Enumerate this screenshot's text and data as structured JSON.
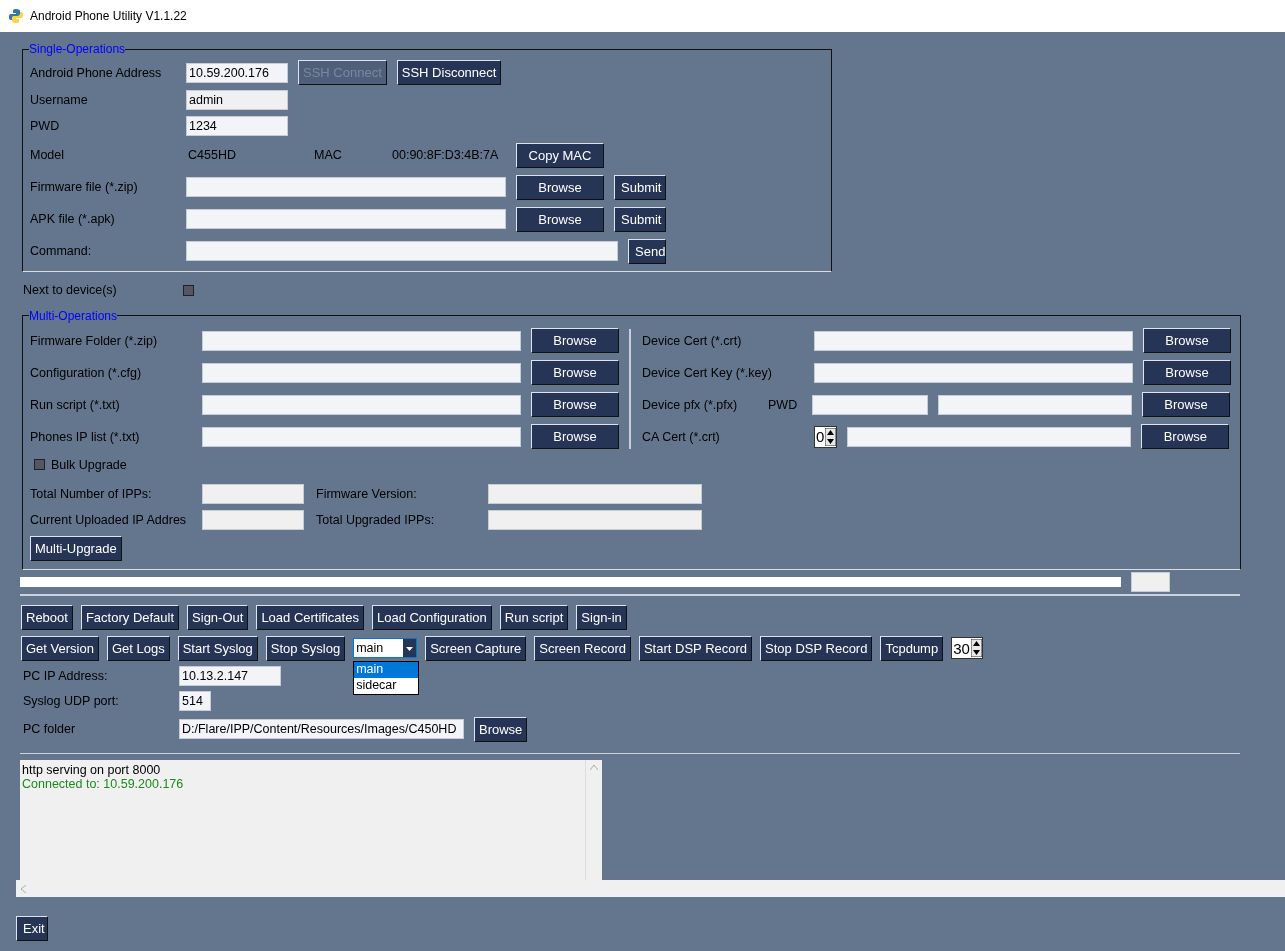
{
  "window": {
    "title": "Android Phone Utility V1.1.22"
  },
  "single_ops": {
    "title": "Single-Operations",
    "address": {
      "label": "Android Phone Address",
      "value": "10.59.200.176"
    },
    "ssh_buttons": [
      {
        "label": "SSH Connect",
        "disabled": true
      },
      {
        "label": "SSH Disconnect",
        "disabled": false
      }
    ],
    "username": {
      "label": "Username",
      "value": "admin"
    },
    "pwd": {
      "label": "PWD",
      "value": "1234"
    },
    "model": {
      "label": "Model",
      "value": "C455HD",
      "mac_label": "MAC",
      "mac_value": "00:90:8F:D3:4B:7A",
      "button": "Copy MAC"
    },
    "files": [
      {
        "label": "Firmware file (*.zip)",
        "browse": "Browse",
        "submit": "Submit"
      },
      {
        "label": "APK file (*.apk)",
        "browse": "Browse",
        "submit": "Submit"
      }
    ],
    "command": {
      "label": "Command:",
      "button": "Send"
    }
  },
  "next_to_device": {
    "label": "Next to device(s)",
    "checked": false
  },
  "multi_ops": {
    "title": "Multi-Operations",
    "left_rows": [
      {
        "label": "Firmware Folder (*.zip)",
        "button": "Browse"
      },
      {
        "label": "Configuration (*.cfg)",
        "button": "Browse"
      },
      {
        "label": "Run script (*.txt)",
        "button": "Browse"
      },
      {
        "label": "Phones IP list (*.txt)",
        "button": "Browse"
      }
    ],
    "right_rows": [
      {
        "kind": "file",
        "label": "Device Cert (*.crt)",
        "button": "Browse"
      },
      {
        "kind": "file",
        "label": "Device Cert Key (*.key)",
        "button": "Browse"
      },
      {
        "kind": "pfx",
        "label": "Device pfx (*.pfx)",
        "pwd_label": "PWD",
        "button": "Browse"
      },
      {
        "kind": "spin",
        "label": "CA Cert (*.crt)",
        "spin_value": "0",
        "button": "Browse"
      }
    ],
    "bulk_upgrade": {
      "label": "Bulk Upgrade",
      "checked": false
    },
    "stats": [
      {
        "label": "Total Number of IPPs:",
        "label2": "Firmware Version:"
      },
      {
        "label": "Current Uploaded IP Addres",
        "label2": "Total Upgraded IPPs:"
      }
    ],
    "button": "Multi-Upgrade"
  },
  "progress": {
    "level": 1
  },
  "actions_row_1": [
    "Reboot",
    "Factory Default",
    "Sign-Out",
    "Load Certificates",
    "Load Configuration",
    "Run script",
    "Sign-in"
  ],
  "actions_row_2": [
    {
      "kind": "button",
      "label": "Get Version"
    },
    {
      "kind": "button",
      "label": "Get Logs"
    },
    {
      "kind": "button",
      "label": "Start Syslog"
    },
    {
      "kind": "button",
      "label": "Stop Syslog"
    },
    {
      "kind": "select",
      "value": "main",
      "expanded": true,
      "options": [
        {
          "label": "main",
          "selected": true
        },
        {
          "label": "sidecar",
          "selected": false
        }
      ]
    },
    {
      "kind": "button",
      "label": "Screen Capture"
    },
    {
      "kind": "button",
      "label": "Screen Record"
    },
    {
      "kind": "button",
      "label": "Start DSP Record"
    },
    {
      "kind": "button",
      "label": "Stop DSP Record"
    },
    {
      "kind": "button",
      "label": "Tcpdump"
    },
    {
      "kind": "spin",
      "value": "30"
    }
  ],
  "pc": [
    {
      "label": "PC IP Address:",
      "value": "10.13.2.147",
      "kind": "ip"
    },
    {
      "label": "Syslog UDP port:",
      "value": "514",
      "kind": "port"
    },
    {
      "label": "PC folder",
      "value": "D:/Flare/IPP/Content/Resources/Images/C450HD",
      "kind": "folder",
      "button": "Browse"
    }
  ],
  "log": [
    {
      "kind": "plain",
      "text": "http serving on port  8000"
    },
    {
      "kind": "status",
      "text": "Connected to: 10.59.200.176"
    }
  ],
  "exit": "Exit"
}
